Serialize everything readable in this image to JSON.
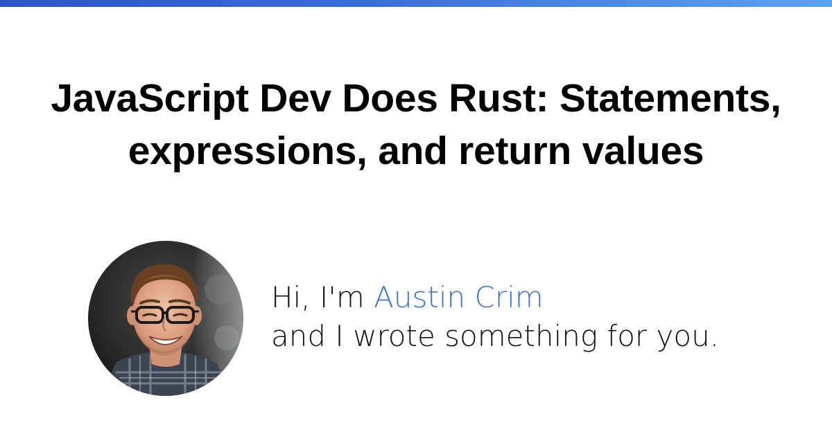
{
  "accent_color": "#3b73d9",
  "topbar_gradient": [
    "#2d55c7",
    "#3a6fd8",
    "#5ea2f3"
  ],
  "title_line_1": "JavaScript Dev Does Rust: Statements,",
  "title_line_2": "expressions, and return values",
  "intro": {
    "greeting": "Hi, I'm ",
    "name": "Austin Crim",
    "tagline": "and I wrote something for you."
  },
  "avatar_icon": "author-photo"
}
